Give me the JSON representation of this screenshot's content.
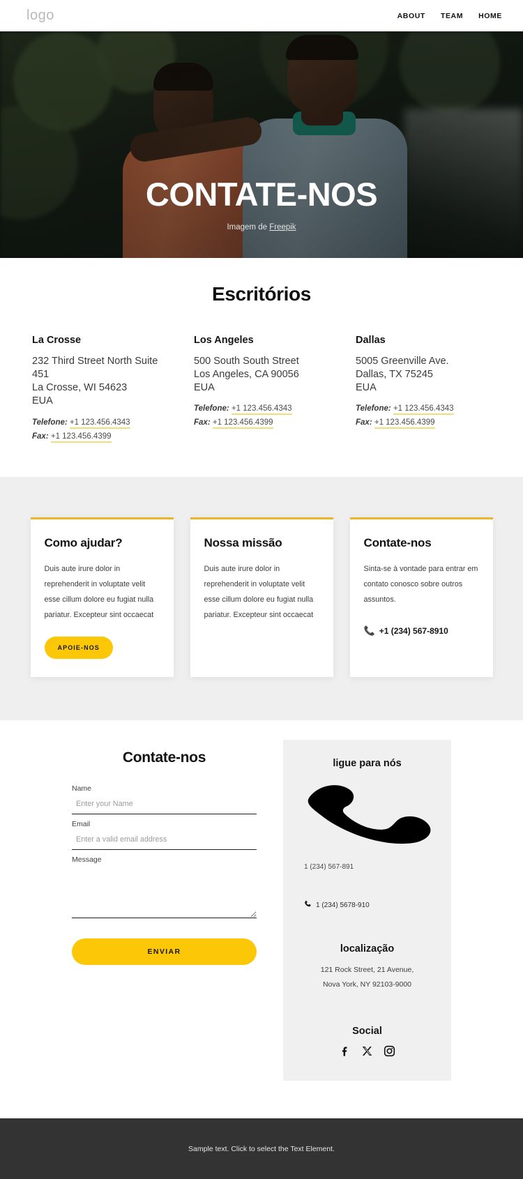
{
  "header": {
    "logo": "logo",
    "nav": [
      {
        "label": "ABOUT"
      },
      {
        "label": "TEAM"
      },
      {
        "label": "HOME"
      }
    ]
  },
  "hero": {
    "title": "CONTATE-NOS",
    "credit_prefix": "Imagem de ",
    "credit_link": "Freepik"
  },
  "offices_section": {
    "title": "Escritórios",
    "phone_label": "Telefone:",
    "fax_label": "Fax:",
    "offices": [
      {
        "city": "La Crosse",
        "address": "232 Third Street North Suite 451\nLa Crosse, WI 54623\nEUA",
        "phone": "+1 123.456.4343",
        "fax": "+1 123.456.4399"
      },
      {
        "city": "Los Angeles",
        "address": "500 South South Street\nLos Angeles, CA 90056\nEUA",
        "phone": "+1 123.456.4343",
        "fax": "+1 123.456.4399"
      },
      {
        "city": "Dallas",
        "address": "5005 Greenville Ave.\nDallas, TX 75245\nEUA",
        "phone": "+1 123.456.4343",
        "fax": "+1 123.456.4399"
      }
    ]
  },
  "cards": [
    {
      "title": "Como ajudar?",
      "text": "Duis aute irure dolor in reprehenderit in voluptate velit esse cillum dolore eu fugiat nulla pariatur. Excepteur sint occaecat",
      "button": "APOIE-NOS"
    },
    {
      "title": "Nossa missão",
      "text": "Duis aute irure dolor in reprehenderit in voluptate velit esse cillum dolore eu fugiat nulla pariatur. Excepteur sint occaecat"
    },
    {
      "title": "Contate-nos",
      "text": "Sinta-se à vontade para entrar em contato conosco sobre outros assuntos.",
      "phone_icon": "phone-icon",
      "phone": "+1 (234) 567-8910"
    }
  ],
  "contact": {
    "title": "Contate-nos",
    "fields": {
      "name_label": "Name",
      "name_placeholder": "Enter your Name",
      "name_value": "",
      "email_label": "Email",
      "email_placeholder": "Enter a valid email address",
      "email_value": "",
      "message_label": "Message",
      "message_placeholder": "",
      "message_value": ""
    },
    "submit": "ENVIAR"
  },
  "side_panel": {
    "title": "ligue para nós",
    "handset_icon": "phone-handset-icon",
    "phone_primary": "1 (234) 567-891",
    "phone_secondary_icon": "phone-icon",
    "phone_secondary": "1 (234) 5678-910",
    "location_title": "localização",
    "location_line1": "121 Rock Street, 21 Avenue,",
    "location_line2": "Nova York, NY 92103-9000",
    "social_title": "Social",
    "social": [
      {
        "name": "facebook-icon"
      },
      {
        "name": "x-twitter-icon"
      },
      {
        "name": "instagram-icon"
      }
    ]
  },
  "footer": {
    "text": "Sample text. Click to select the Text Element."
  },
  "colors": {
    "accent_yellow": "#fbc707",
    "card_border": "#e8b52b",
    "link_underline": "#f2dd7a",
    "band_gray": "#efefef",
    "panel_gray": "#f0f0f0",
    "footer_dark": "#333333"
  }
}
